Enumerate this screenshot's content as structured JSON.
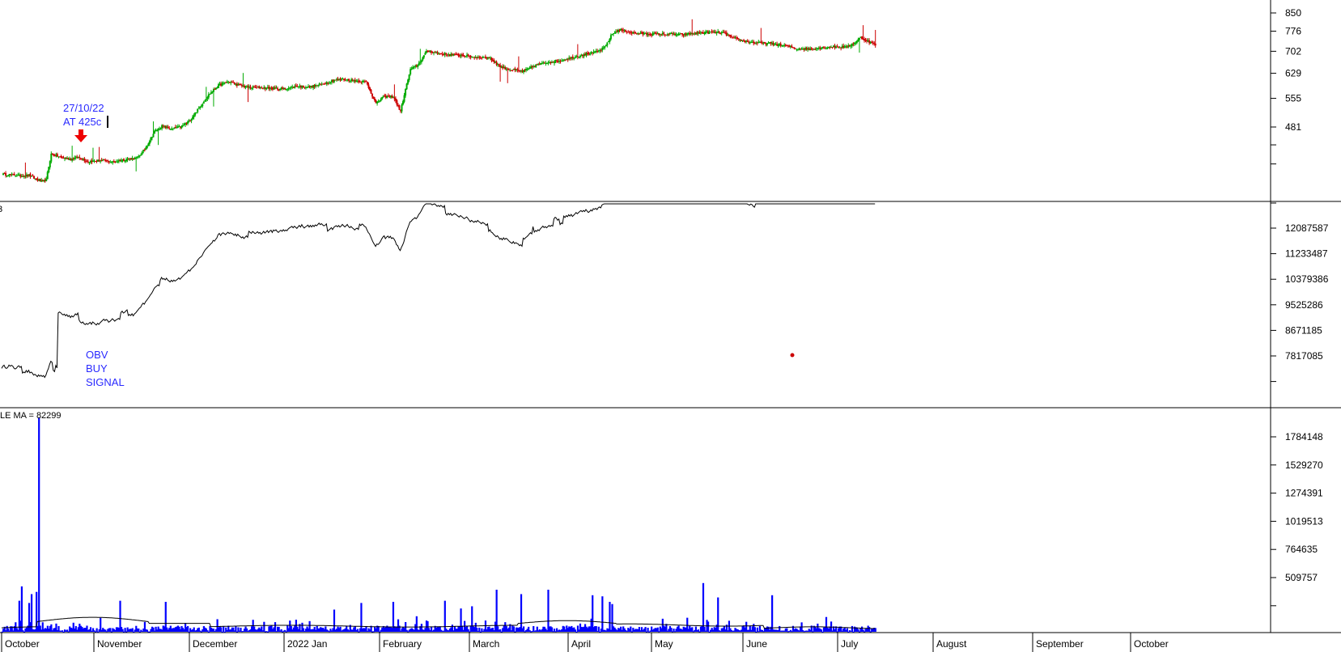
{
  "chart_data": {
    "type": "candlestick_with_obv_and_volume",
    "price_pane": {
      "y_ticks": [
        850,
        776,
        702,
        629,
        555,
        481
      ],
      "annotation_date": "27/10/22",
      "annotation_price": "AT 425c",
      "close_points": [
        [
          0,
          380
        ],
        [
          8,
          379
        ],
        [
          15,
          377
        ],
        [
          22,
          378
        ],
        [
          28,
          370
        ],
        [
          33,
          366
        ],
        [
          36,
          370
        ],
        [
          40,
          420
        ],
        [
          48,
          413
        ],
        [
          56,
          410
        ],
        [
          62,
          414
        ],
        [
          70,
          405
        ],
        [
          80,
          407
        ],
        [
          90,
          404
        ],
        [
          100,
          409
        ],
        [
          110,
          412
        ],
        [
          116,
          430
        ],
        [
          124,
          470
        ],
        [
          130,
          483
        ],
        [
          138,
          476
        ],
        [
          146,
          482
        ],
        [
          152,
          495
        ],
        [
          160,
          528
        ],
        [
          168,
          565
        ],
        [
          176,
          592
        ],
        [
          184,
          603
        ],
        [
          192,
          593
        ],
        [
          200,
          586
        ],
        [
          210,
          586
        ],
        [
          220,
          583
        ],
        [
          230,
          582
        ],
        [
          240,
          590
        ],
        [
          250,
          587
        ],
        [
          260,
          596
        ],
        [
          270,
          608
        ],
        [
          278,
          610
        ],
        [
          288,
          606
        ],
        [
          296,
          602
        ],
        [
          304,
          540
        ],
        [
          310,
          560
        ],
        [
          318,
          560
        ],
        [
          324,
          520
        ],
        [
          332,
          640
        ],
        [
          338,
          656
        ],
        [
          346,
          705
        ],
        [
          354,
          695
        ],
        [
          364,
          690
        ],
        [
          374,
          688
        ],
        [
          384,
          682
        ],
        [
          396,
          680
        ],
        [
          406,
          648
        ],
        [
          414,
          640
        ],
        [
          424,
          635
        ],
        [
          434,
          655
        ],
        [
          444,
          665
        ],
        [
          454,
          670
        ],
        [
          464,
          681
        ],
        [
          474,
          692
        ],
        [
          484,
          700
        ],
        [
          490,
          716
        ],
        [
          496,
          765
        ],
        [
          502,
          782
        ],
        [
          512,
          770
        ],
        [
          522,
          766
        ],
        [
          532,
          765
        ],
        [
          542,
          765
        ],
        [
          552,
          762
        ],
        [
          564,
          768
        ],
        [
          576,
          772
        ],
        [
          586,
          770
        ],
        [
          594,
          750
        ],
        [
          602,
          740
        ],
        [
          612,
          732
        ],
        [
          624,
          730
        ],
        [
          636,
          722
        ],
        [
          646,
          712
        ],
        [
          656,
          710
        ],
        [
          666,
          715
        ],
        [
          676,
          718
        ],
        [
          686,
          716
        ],
        [
          694,
          735
        ],
        [
          698,
          752
        ],
        [
          704,
          738
        ],
        [
          710,
          725
        ]
      ]
    },
    "obv_pane": {
      "y_ticks": [
        12087587,
        11233487,
        10379386,
        9525286,
        8671185,
        7817085
      ],
      "annotation": [
        "OBV",
        "BUY",
        "SIGNAL"
      ]
    },
    "volume_pane": {
      "label": "LE MA = 82299",
      "y_ticks": [
        1784148,
        1529270,
        1274391,
        1019513,
        764635,
        509757
      ]
    },
    "x_axis": {
      "months": [
        "October",
        "November",
        "December",
        "2022 Jan",
        "February",
        "March",
        "April",
        "May",
        "June",
        "July",
        "August",
        "September",
        "October"
      ],
      "days_per_month": [
        16,
        22,
        20,
        21,
        20,
        21,
        19,
        21,
        21,
        21,
        22,
        22,
        20
      ]
    },
    "colors": {
      "up_candle": "#00aa00",
      "down_candle": "#cc0000",
      "volume_bar": "#0000ff",
      "annotation_text": "#2a2aff",
      "arrow": "#ee0000",
      "line": "#000000"
    }
  }
}
